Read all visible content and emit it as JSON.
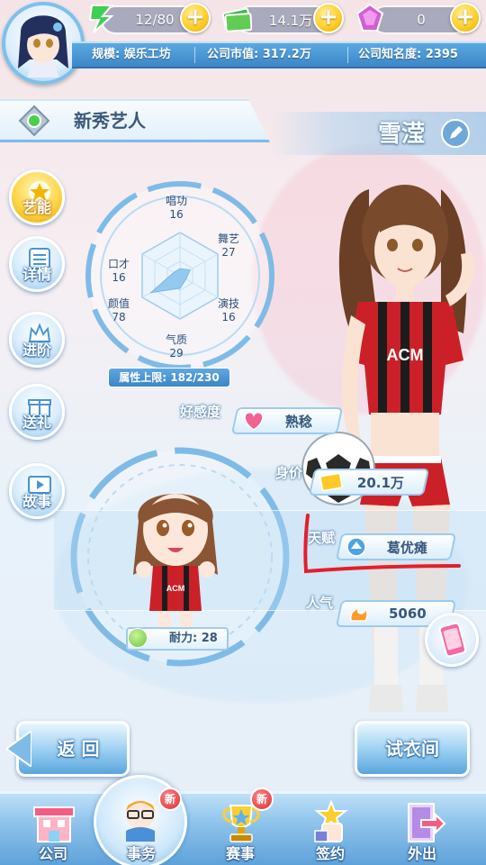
{
  "resources": {
    "energy": "12/80",
    "cash": "14.1万",
    "gems": "0"
  },
  "company_stats": {
    "scale": "规模: 娱乐工坊",
    "market_value": "公司市值: 317.2万",
    "fame": "公司知名度: 2395"
  },
  "header": {
    "title": "新秀艺人",
    "artist_name": "雪滢"
  },
  "side_menu": [
    {
      "label": "艺能",
      "icon": "star-icon",
      "active": true
    },
    {
      "label": "详情",
      "icon": "list-icon",
      "active": false
    },
    {
      "label": "进阶",
      "icon": "crown-icon",
      "active": false
    },
    {
      "label": "送礼",
      "icon": "gift-icon",
      "active": false
    },
    {
      "label": "故事",
      "icon": "play-icon",
      "active": false
    }
  ],
  "attributes": {
    "singing_label": "唱功",
    "singing": "16",
    "dance_label": "舞艺",
    "dance": "27",
    "acting_label": "演技",
    "acting": "16",
    "temperament_label": "气质",
    "temperament": "29",
    "looks_label": "颜值",
    "looks": "78",
    "eloquence_label": "口才",
    "eloquence": "16",
    "limit": "属性上限: 182/230"
  },
  "info_rows": {
    "affinity_label": "好感度",
    "affinity_value": "熟稔",
    "price_label": "身价",
    "price_value": "20.1万",
    "talent_label": "天赋",
    "talent_value": "葛优瘫",
    "popularity_label": "人气",
    "popularity_value": "5060"
  },
  "stamina": "耐力: 28",
  "buttons": {
    "back": "返 回",
    "wardrobe": "试衣间"
  },
  "tabs": [
    {
      "label": "公司",
      "icon": "building-icon",
      "new": false
    },
    {
      "label": "事务",
      "icon": "manager-icon",
      "new": true,
      "active": true
    },
    {
      "label": "赛事",
      "icon": "trophy-icon",
      "new": true
    },
    {
      "label": "签约",
      "icon": "contract-icon",
      "new": false
    },
    {
      "label": "外出",
      "icon": "door-icon",
      "new": false
    }
  ],
  "new_badge": "新",
  "colors": {
    "accent_blue": "#4a94d4",
    "gold": "#ffd02a",
    "annotation_red": "#e21f2b"
  }
}
